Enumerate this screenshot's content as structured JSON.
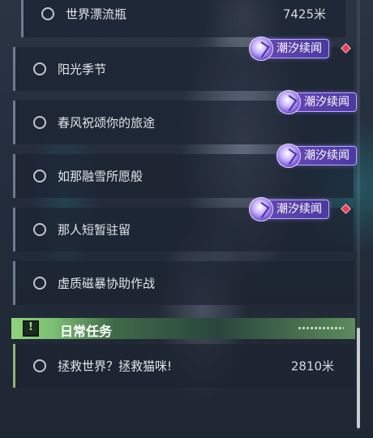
{
  "quests": [
    {
      "title": "世界漂流瓶",
      "distance": "7425米"
    },
    {
      "title": "阳光季节",
      "badge": "潮汐续闻"
    },
    {
      "title": "春风祝颂你的旅途",
      "badge": "潮汐续闻"
    },
    {
      "title": "如那融雪所愿般",
      "badge": "潮汐续闻"
    },
    {
      "title": "那人短暂驻留",
      "badge": "潮汐续闻"
    },
    {
      "title": "虚质磁暴协助作战"
    }
  ],
  "daily_section": {
    "title": "日常任务",
    "icon": "alert-icon"
  },
  "daily_quests": [
    {
      "title": "拯救世界？拯救猫咪!",
      "distance": "2810米"
    }
  ],
  "colors": {
    "badge": "#6b49b8",
    "section_accent": "#8fd47c",
    "marker": "#e2405a"
  }
}
